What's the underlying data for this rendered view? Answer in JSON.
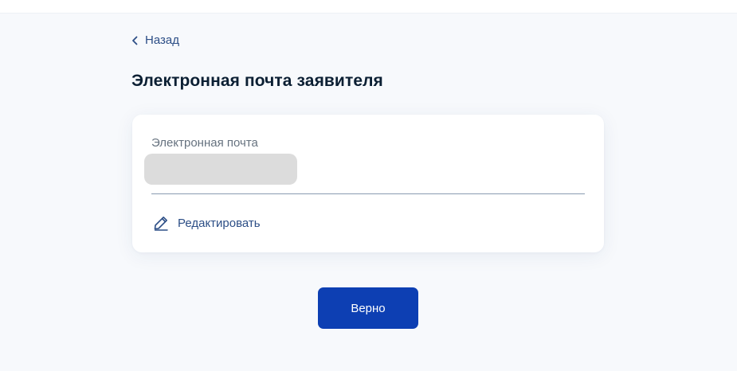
{
  "header": {
    "back_label": "Назад"
  },
  "page": {
    "title": "Электронная почта заявителя"
  },
  "card": {
    "field_label": "Электронная почта",
    "field_value": "",
    "edit_label": "Редактировать"
  },
  "actions": {
    "confirm_label": "Верно"
  },
  "colors": {
    "accent": "#0d3fb3",
    "link": "#2c4e86",
    "background": "#f7f9fc",
    "masked_value": "#dcdcdc"
  },
  "icons": {
    "back": "chevron-left-icon",
    "edit": "pencil-icon"
  }
}
